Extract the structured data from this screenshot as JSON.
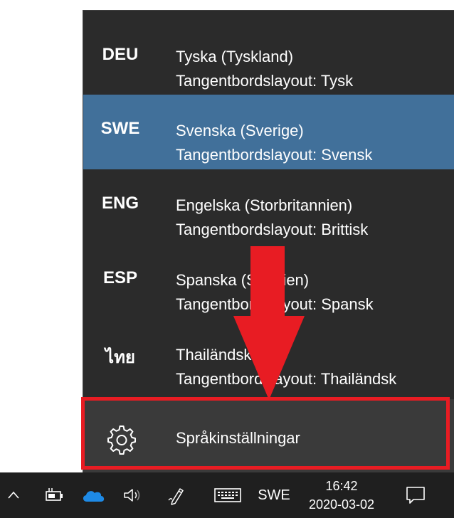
{
  "language_flyout": {
    "items": [
      {
        "code": "DEU",
        "name": "Tyska (Tyskland)",
        "layout": "Tangentbordslayout: Tysk",
        "selected": false
      },
      {
        "code": "SWE",
        "name": "Svenska (Sverige)",
        "layout": "Tangentbordslayout: Svensk",
        "selected": true
      },
      {
        "code": "ENG",
        "name": "Engelska (Storbritannien)",
        "layout": "Tangentbordslayout: Brittisk",
        "selected": false
      },
      {
        "code": "ESP",
        "name": "Spanska (Spanien)",
        "layout": "Tangentbordslayout: Spansk",
        "selected": false
      },
      {
        "code": "ไทย",
        "name": "Thailändska",
        "layout": "Tangentbordslayout: Thailändsk",
        "selected": false
      }
    ],
    "settings_label": "Språkinställningar",
    "settings_icon": "gear-icon"
  },
  "annotation": {
    "arrow_color": "#e81c23",
    "highlight_color": "#e81c23"
  },
  "taskbar": {
    "icons": [
      "chevron-up-icon",
      "battery-charging-icon",
      "onedrive-cloud-icon",
      "volume-icon",
      "pen-icon",
      "touch-keyboard-icon"
    ],
    "input_indicator": "SWE",
    "time": "16:42",
    "date": "2020-03-02",
    "action_center_icon": "notification-icon"
  },
  "colors": {
    "flyout_bg": "#2b2b2b",
    "selected_bg": "#41709a",
    "settings_bg": "#3a3a3a",
    "taskbar_bg": "#1f1f1f",
    "onedrive_blue": "#1e8ae6"
  }
}
